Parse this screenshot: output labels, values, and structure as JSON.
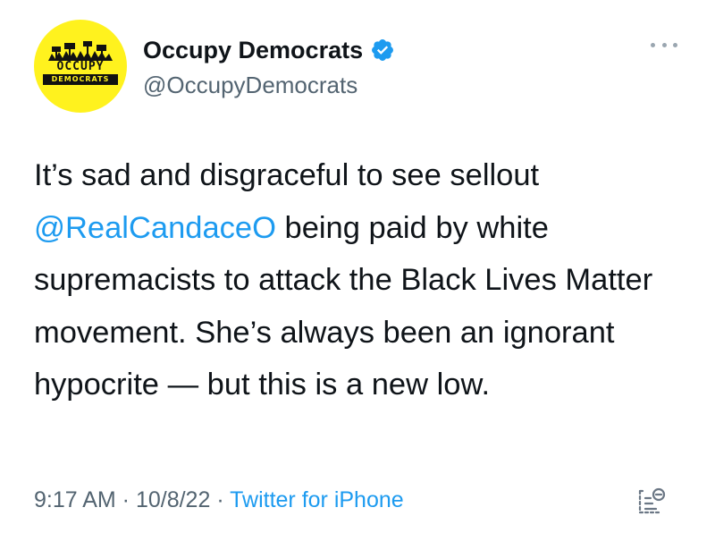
{
  "author": {
    "display_name": "Occupy Democrats",
    "handle": "@OccupyDemocrats",
    "verified": true,
    "avatar": {
      "background": "#fff21e",
      "logo_top": "OCCUPY",
      "logo_bottom": "DEMOCRATS"
    }
  },
  "tweet": {
    "text_before": "It’s sad and disgraceful to see sellout ",
    "mention": "@RealCandaceO",
    "text_after": " being paid by white supremacists to attack the Black Lives Matter movement. She’s always been an ignorant hypocrite — but this is a new low."
  },
  "meta": {
    "time": "9:17 AM",
    "separator": " · ",
    "date": "10/8/22",
    "source": "Twitter for iPhone"
  },
  "icons": {
    "verified": "verified-badge-icon",
    "more": "more-options-icon",
    "analytics": "view-analytics-icon"
  },
  "colors": {
    "link": "#1d9bf0",
    "text": "#0f1419",
    "secondary": "#536471",
    "verified": "#1d9bf0"
  }
}
